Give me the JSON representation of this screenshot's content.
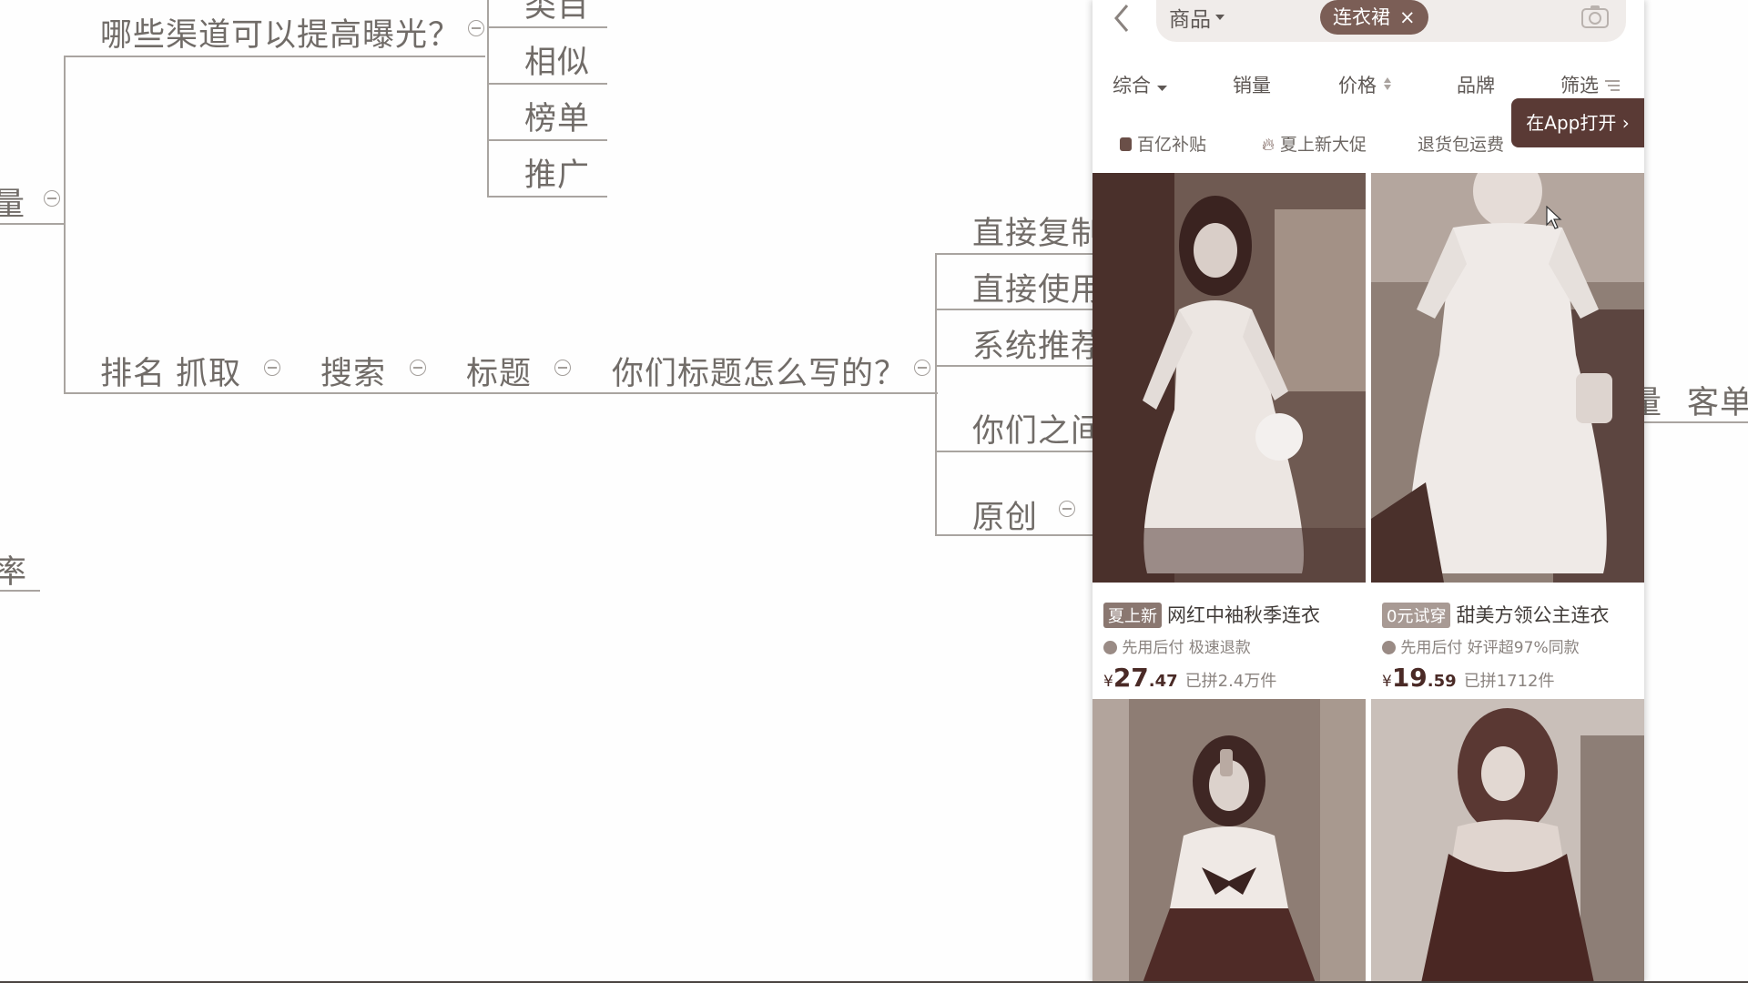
{
  "mindmap": {
    "left_edge_top": "量",
    "left_edge_bottom": "率",
    "exposure_question": "哪些渠道可以提高曝光？",
    "channels": [
      "类目",
      "相似",
      "榜单",
      "推广"
    ],
    "chain": [
      "排名",
      "抓取",
      "搜索",
      "标题",
      "你们标题怎么写的？"
    ],
    "title_methods": [
      "直接复制",
      "直接使用",
      "系统推荐",
      "你们之间",
      "原创"
    ],
    "right_edge": [
      "量",
      "客单"
    ]
  },
  "phone": {
    "search": {
      "category": "商品",
      "chip_label": "连衣裙",
      "chip_close": "×"
    },
    "sort_tabs": [
      "综合",
      "销量",
      "价格",
      "品牌",
      "筛选"
    ],
    "promos": [
      "百亿补贴",
      "夏上新大促",
      "退货包运费"
    ],
    "open_app_label": "在App打开",
    "products": [
      {
        "badge": "夏上新",
        "title": "网红中袖秋季连衣",
        "tags": "先用后付  极速退款",
        "currency": "¥",
        "price_int": "27",
        "price_dec": ".47",
        "sold": "已拼2.4万件"
      },
      {
        "badge": "0元试穿",
        "title": "甜美方领公主连衣",
        "tags": "先用后付  好评超97%同款",
        "currency": "¥",
        "price_int": "19",
        "price_dec": ".59",
        "sold": "已拼1712件"
      }
    ]
  },
  "colors": {
    "chip_bg": "#7b5e56",
    "open_app_bg": "#5a3a35",
    "mindmap_text": "#716c68",
    "mindmap_line": "#a9a4a0"
  }
}
